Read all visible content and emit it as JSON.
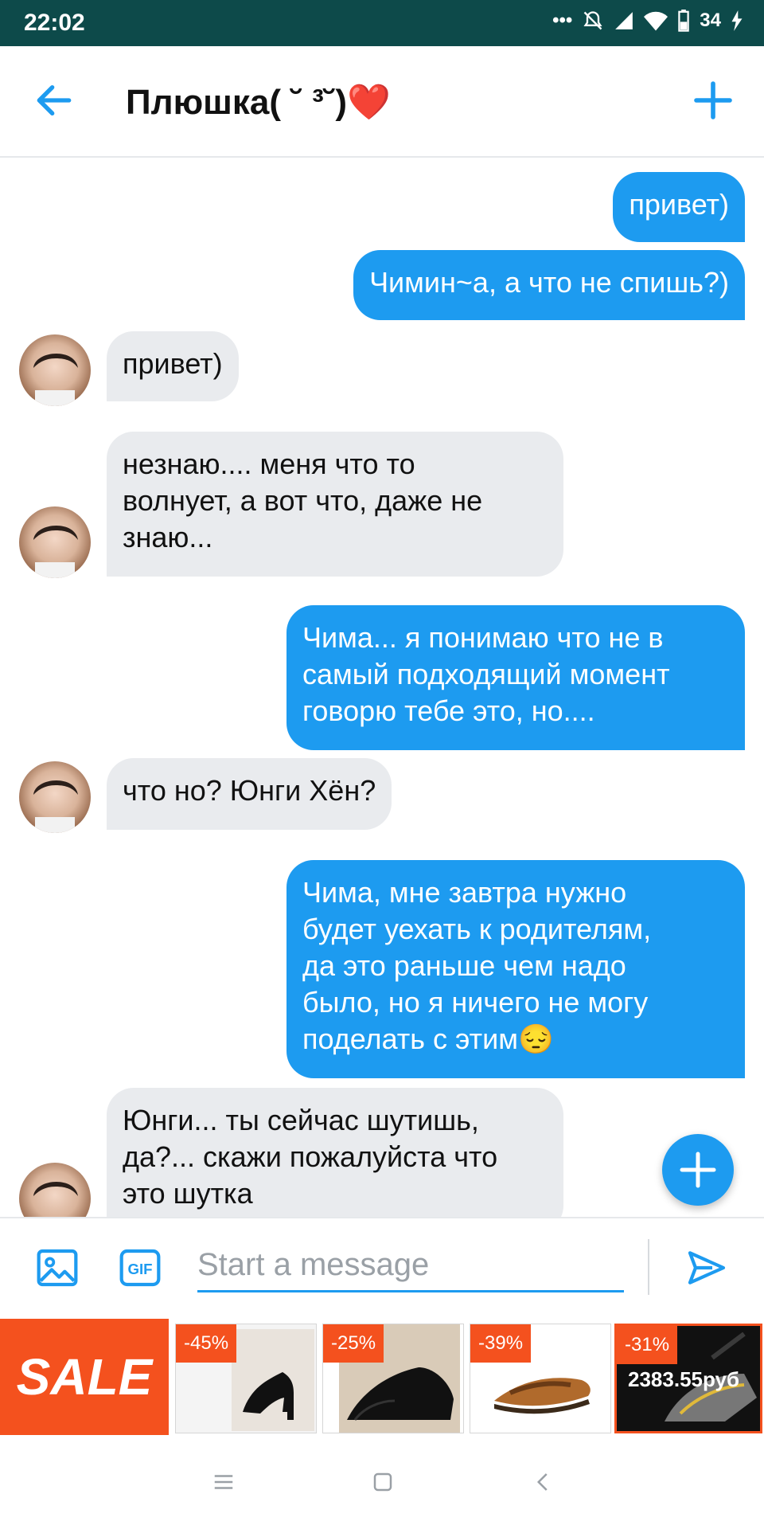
{
  "status_bar": {
    "time": "22:02",
    "battery": "34"
  },
  "header": {
    "title": "Плюшка( ˘ ³˘)❤️"
  },
  "messages": [
    {
      "side": "out",
      "text": "привет)"
    },
    {
      "side": "out",
      "text": "Чимин~а, а что не спишь?)"
    },
    {
      "side": "in",
      "text": "привет)"
    },
    {
      "side": "in",
      "lines": [
        "незнаю.... меня что то",
        "волнует, а вот что, даже не",
        "знаю..."
      ]
    },
    {
      "side": "out",
      "lines": [
        "Чима... я понимаю что не в",
        "самый подходящий момент",
        "говорю тебе это, но...."
      ]
    },
    {
      "side": "in",
      "text": "что но? Юнги Хён?"
    },
    {
      "side": "out",
      "lines": [
        "Чима, мне завтра нужно",
        "будет уехать к родителям,",
        "да это раньше чем надо",
        "было, но я ничего не могу",
        "поделать с этим😔"
      ]
    },
    {
      "side": "in",
      "lines": [
        "Юнги... ты сейчас шутишь,",
        "да?... скажи пожалуйста что",
        "это шутка"
      ]
    }
  ],
  "compose": {
    "placeholder": "Start a message",
    "gif_label": "GIF"
  },
  "ads": {
    "sale_label": "SALE",
    "items": [
      {
        "discount": "-45%",
        "image": "black-heels-shoe"
      },
      {
        "discount": "-25%",
        "image": "black-loafer-shoe"
      },
      {
        "discount": "-39%",
        "image": "brown-sandal"
      },
      {
        "discount": "-31%",
        "price": "2383.55руб",
        "image": "dark-sneaker"
      }
    ]
  },
  "colors": {
    "accent": "#1d9bf0",
    "status_bar": "#0d4a4a",
    "incoming_bubble": "#e9ebee",
    "sale": "#f4511e"
  }
}
